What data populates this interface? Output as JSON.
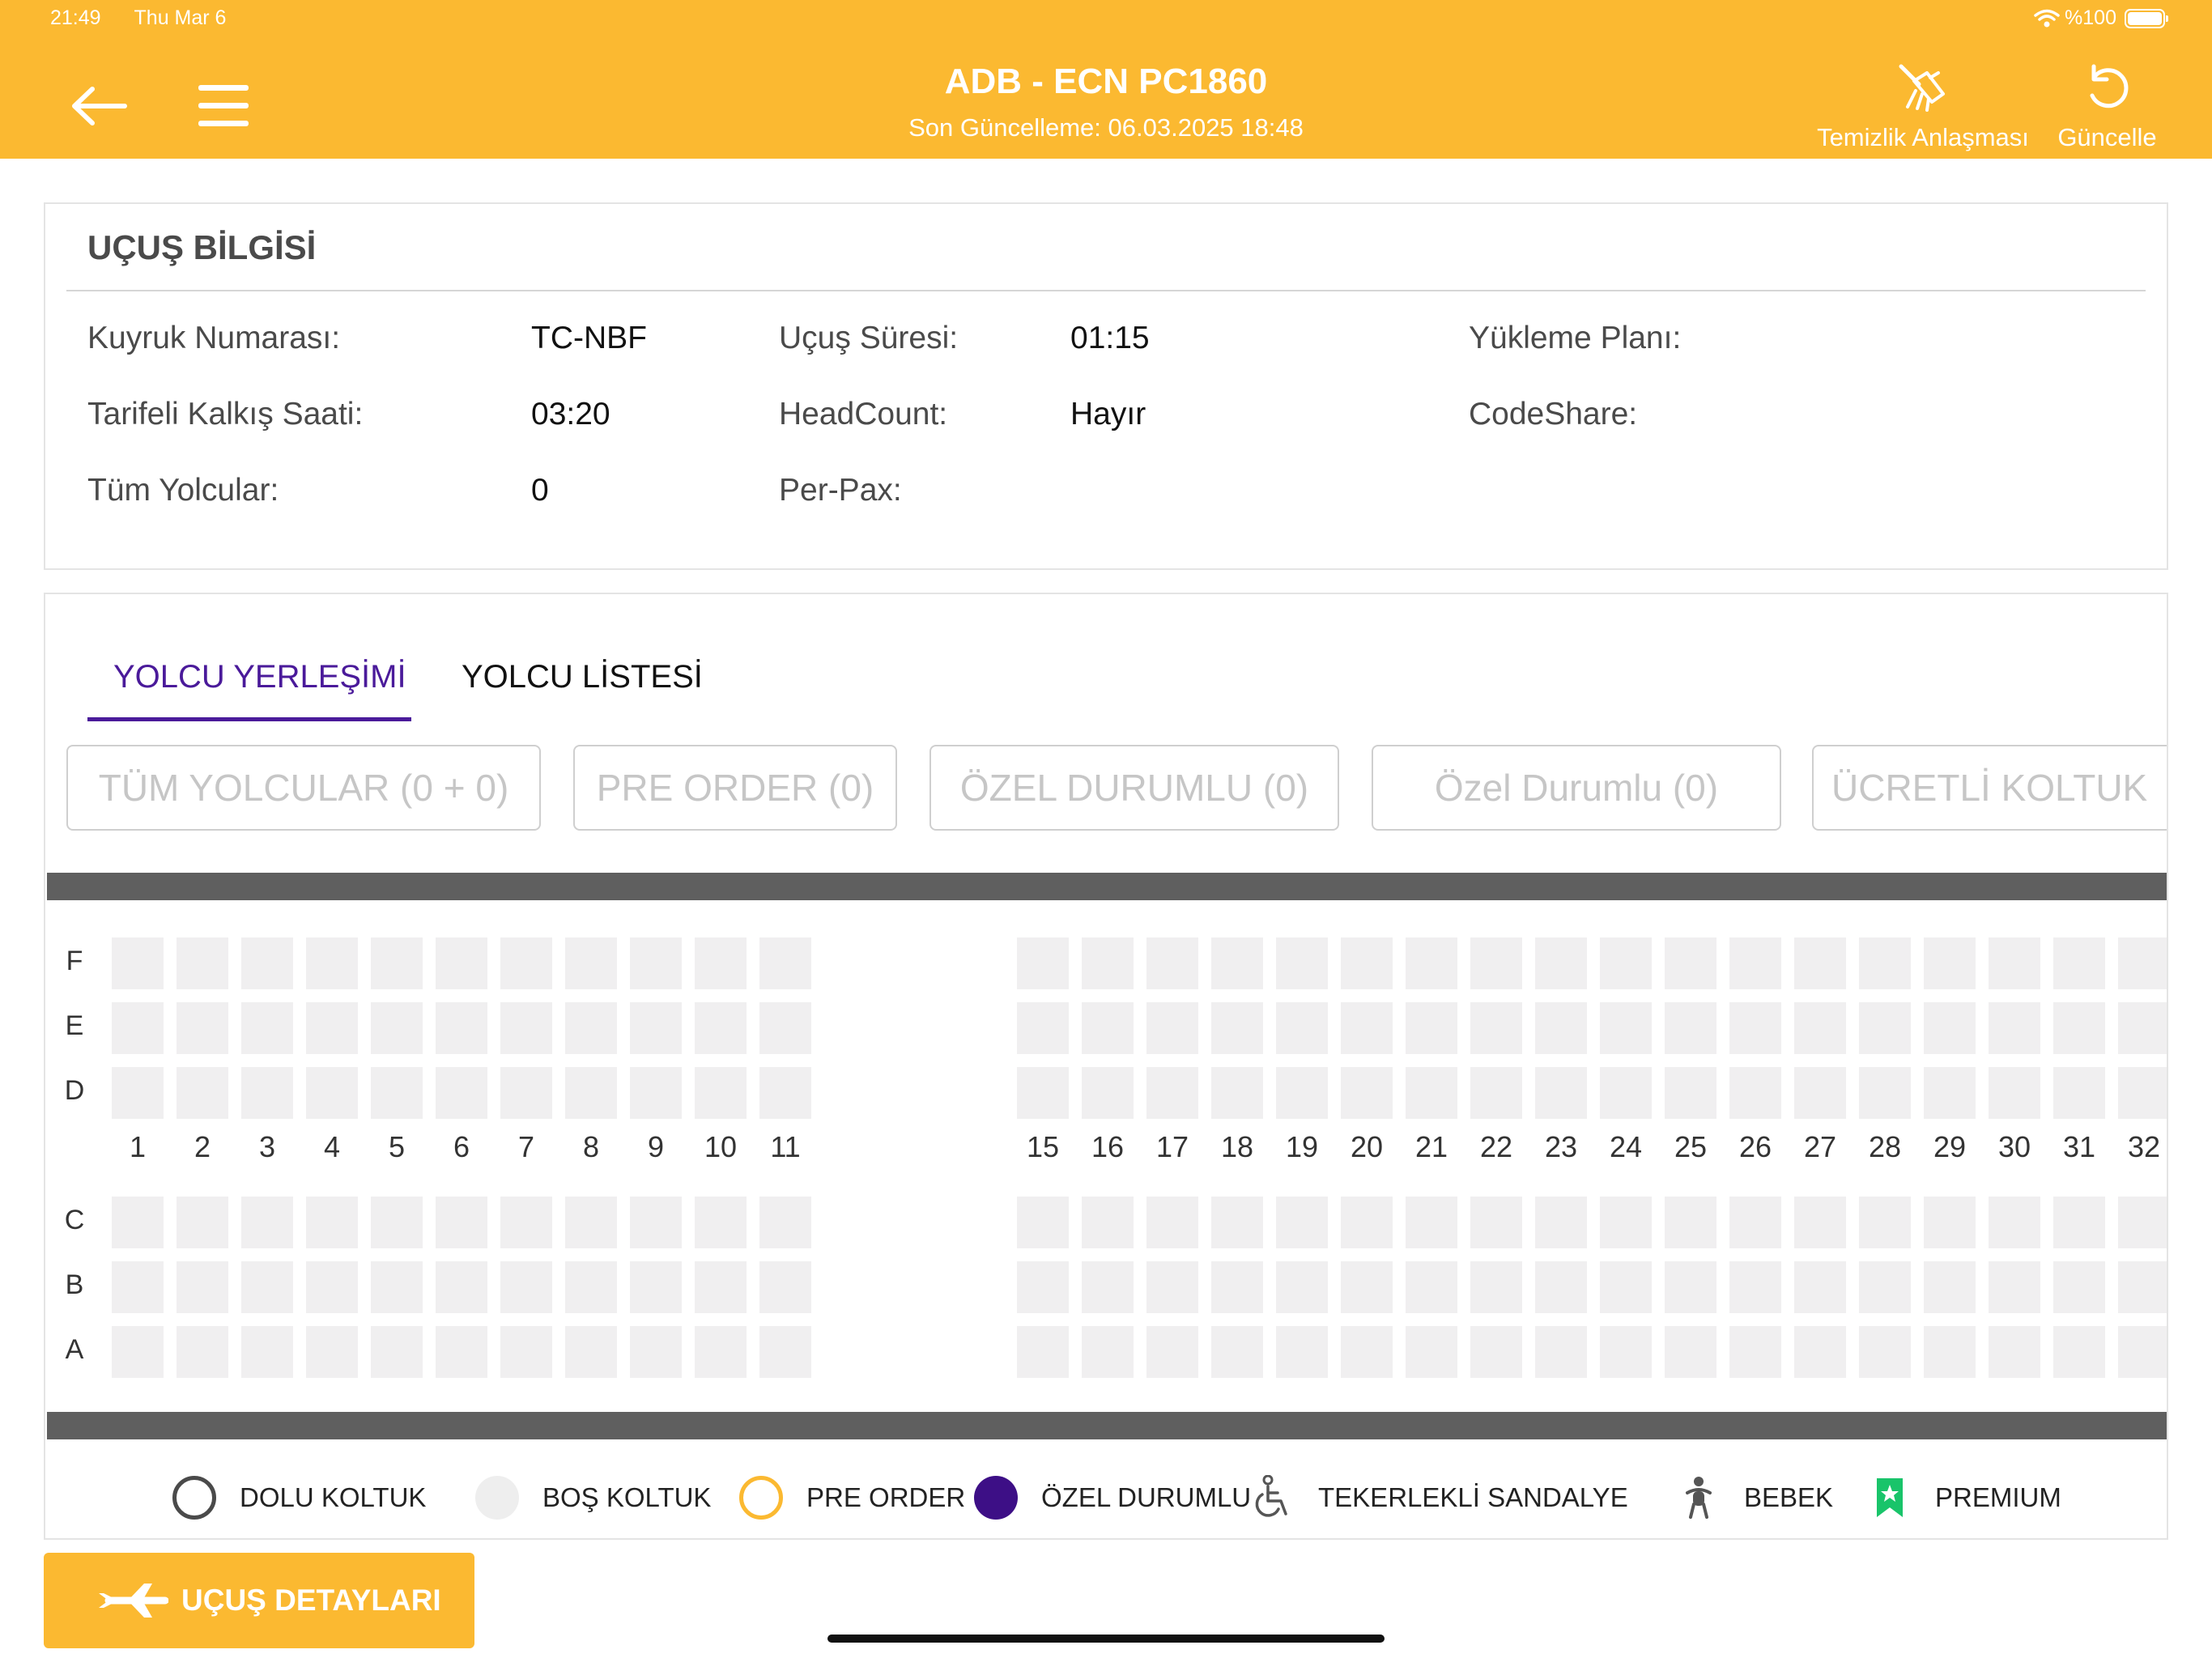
{
  "status_bar": {
    "time": "21:49",
    "date": "Thu Mar 6",
    "battery": "%100"
  },
  "header": {
    "title": "ADB - ECN  PC1860",
    "subtitle": "Son Güncelleme: 06.03.2025 18:48",
    "actions": {
      "clean": "Temizlik Anlaşması",
      "refresh": "Güncelle"
    },
    "back_icon": "arrow-left-icon",
    "menu_icon": "hamburger-menu-icon"
  },
  "flight_info": {
    "title": "UÇUŞ BİLGİSİ",
    "fields": [
      {
        "label": "Kuyruk Numarası:",
        "value": "TC-NBF"
      },
      {
        "label": "Uçuş Süresi:",
        "value": "01:15"
      },
      {
        "label": "Yükleme Planı:",
        "value": ""
      },
      {
        "label": "Tarifeli Kalkış Saati:",
        "value": "03:20"
      },
      {
        "label": "HeadCount:",
        "value": "Hayır"
      },
      {
        "label": "CodeShare:",
        "value": ""
      },
      {
        "label": "Tüm Yolcular:",
        "value": "0"
      },
      {
        "label": "Per-Pax:",
        "value": ""
      }
    ]
  },
  "tabs": [
    {
      "label": "YOLCU YERLEŞİMİ",
      "active": true
    },
    {
      "label": "YOLCU LİSTESİ",
      "active": false
    }
  ],
  "filters": [
    "TÜM YOLCULAR (0 + 0)",
    "PRE ORDER (0)",
    "ÖZEL DURUMLU (0)",
    "Özel Durumlu (0)",
    "ÜCRETLİ KOLTUK"
  ],
  "seat_map": {
    "upper_rows": [
      "F",
      "E",
      "D"
    ],
    "lower_rows": [
      "C",
      "B",
      "A"
    ],
    "columns_front": [
      "1",
      "2",
      "3",
      "4",
      "5",
      "6",
      "7",
      "8",
      "9",
      "10",
      "11"
    ],
    "columns_rear": [
      "15",
      "16",
      "17",
      "18",
      "19",
      "20",
      "21",
      "22",
      "23",
      "24",
      "25",
      "26",
      "27",
      "28",
      "29",
      "30",
      "31",
      "32"
    ],
    "seat_state": "empty",
    "empty_seat_color": "#f0eff0",
    "fuselage_color": "#5f5f5f"
  },
  "legend": [
    {
      "label": "DOLU KOLTUK",
      "icon": "occupied-seat-circle-icon"
    },
    {
      "label": "BOŞ KOLTUK",
      "icon": "empty-seat-circle-icon"
    },
    {
      "label": "PRE ORDER",
      "icon": "pre-order-circle-icon"
    },
    {
      "label": "ÖZEL DURUMLU",
      "icon": "special-status-circle-icon"
    },
    {
      "label": "TEKERLEKLİ SANDALYE",
      "icon": "wheelchair-icon"
    },
    {
      "label": "BEBEK",
      "icon": "baby-icon"
    },
    {
      "label": "PREMIUM",
      "icon": "premium-bookmark-star-icon"
    }
  ],
  "colors": {
    "brand": "#fbb931",
    "accent": "#4a1a9a",
    "pre_order": "#fbb931",
    "special": "#3d0f86",
    "premium": "#19c46a"
  },
  "bottom_button": {
    "label": "UÇUŞ DETAYLARI",
    "icon": "plane-landing-icon"
  }
}
